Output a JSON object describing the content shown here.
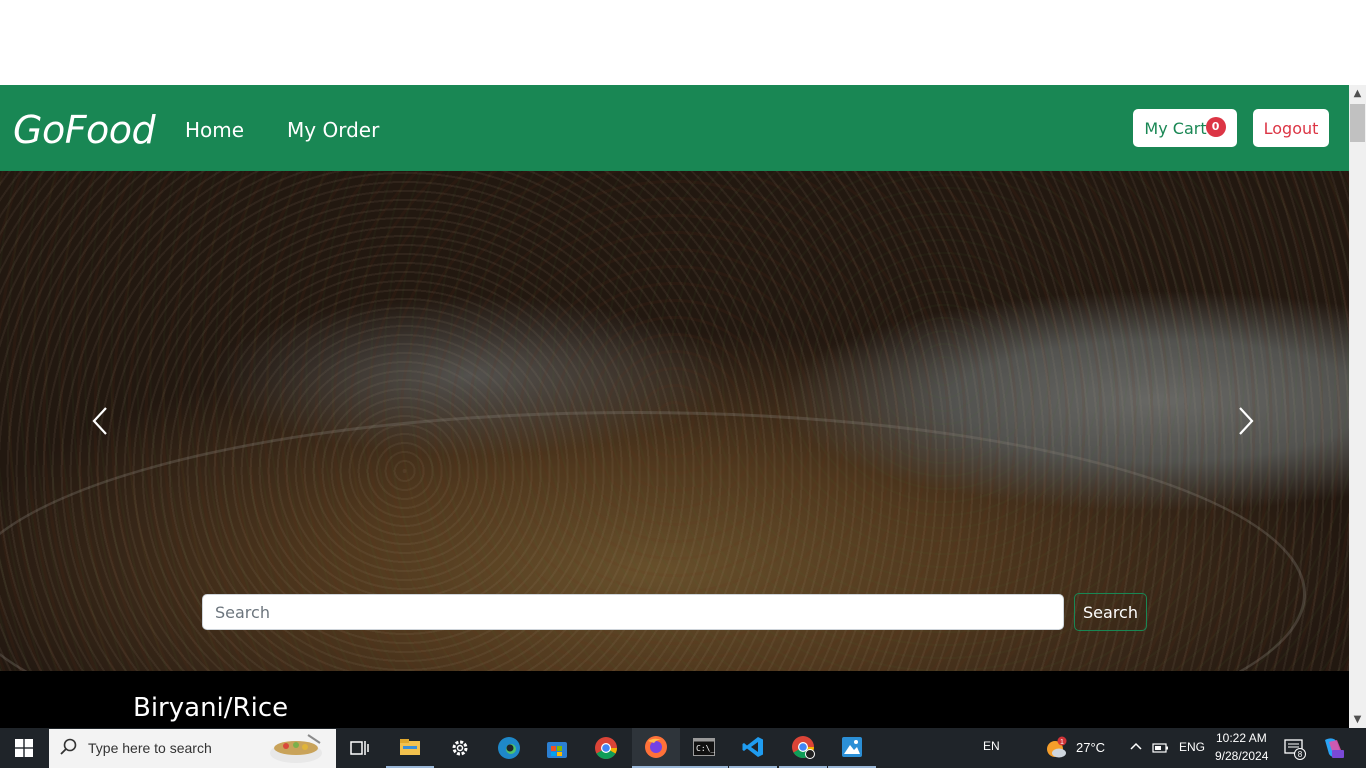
{
  "navbar": {
    "brand": "GoFood",
    "links": [
      "Home",
      "My Order"
    ],
    "cart_label": "My Cart",
    "cart_count": "0",
    "logout_label": "Logout",
    "bg_color": "#198754"
  },
  "hero": {
    "search_placeholder": "Search",
    "search_button": "Search",
    "prev_icon": "chevron-left-icon",
    "next_icon": "chevron-right-icon"
  },
  "category": {
    "title": "Biryani/Rice"
  },
  "taskbar": {
    "search_placeholder": "Type here to search",
    "apps": [
      "task-view-icon",
      "file-explorer-icon",
      "settings-icon",
      "edge-icon",
      "store-icon",
      "chrome-icon",
      "firefox-icon",
      "terminal-icon",
      "vscode-icon",
      "chrome-profile-icon",
      "photos-icon"
    ],
    "lang": "EN",
    "weather_temp": "27°C",
    "weather_badge": "1",
    "ime": "ENG",
    "time": "10:22 AM",
    "date": "9/28/2024",
    "notification_count": "8"
  }
}
